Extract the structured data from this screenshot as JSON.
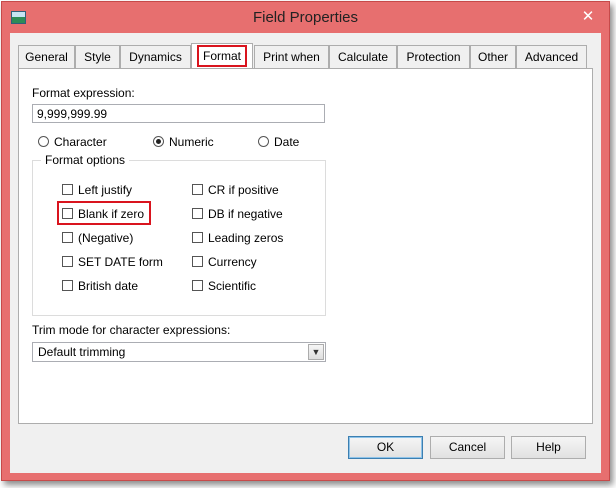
{
  "window": {
    "title": "Field Properties",
    "close_glyph": "✕",
    "icon": "app-window-icon"
  },
  "tabs": [
    {
      "label": "General",
      "active": false
    },
    {
      "label": "Style",
      "active": false
    },
    {
      "label": "Dynamics",
      "active": false
    },
    {
      "label": "Format",
      "active": true
    },
    {
      "label": "Print when",
      "active": false
    },
    {
      "label": "Calculate",
      "active": false
    },
    {
      "label": "Protection",
      "active": false
    },
    {
      "label": "Other",
      "active": false
    },
    {
      "label": "Advanced",
      "active": false
    }
  ],
  "format_expression": {
    "label": "Format expression:",
    "value": "9,999,999.99"
  },
  "type_options": [
    {
      "label": "Character",
      "checked": false
    },
    {
      "label": "Numeric",
      "checked": true
    },
    {
      "label": "Date",
      "checked": false
    }
  ],
  "format_options": {
    "title": "Format options",
    "left_column": [
      {
        "label": "Left justify",
        "checked": false
      },
      {
        "label": "Blank if zero",
        "checked": false
      },
      {
        "label": "(Negative)",
        "checked": false
      },
      {
        "label": "SET DATE format",
        "checked": false
      },
      {
        "label": "British date",
        "checked": false
      }
    ],
    "right_column": [
      {
        "label": "CR if positive",
        "checked": false
      },
      {
        "label": "DB if negative",
        "checked": false
      },
      {
        "label": "Leading zeros",
        "checked": false
      },
      {
        "label": "Currency",
        "checked": false
      },
      {
        "label": "Scientific",
        "checked": false
      }
    ]
  },
  "trim_mode": {
    "label": "Trim mode for character expressions:",
    "value": "Default trimming"
  },
  "buttons": {
    "ok": "OK",
    "cancel": "Cancel",
    "help": "Help"
  },
  "colors": {
    "frame": "#e76f6f",
    "highlight": "#d9141e"
  }
}
